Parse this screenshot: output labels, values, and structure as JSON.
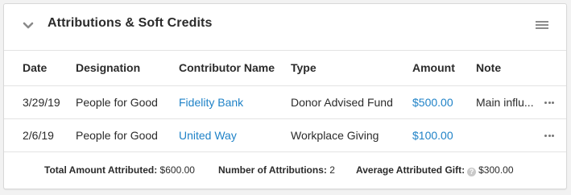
{
  "panel": {
    "title": "Attributions & Soft Credits",
    "collapse_icon": "chevron-down-icon",
    "menu_icon": "hamburger-menu-icon"
  },
  "table": {
    "columns": [
      "Date",
      "Designation",
      "Contributor Name",
      "Type",
      "Amount",
      "Note"
    ],
    "rows": [
      {
        "date": "3/29/19",
        "designation": "People for Good",
        "contributor": "Fidelity Bank",
        "type": "Donor Advised Fund",
        "amount": "$500.00",
        "note": "Main influ..."
      },
      {
        "date": "2/6/19",
        "designation": "People for Good",
        "contributor": "United Way",
        "type": "Workplace Giving",
        "amount": "$100.00",
        "note": ""
      }
    ]
  },
  "summary": {
    "total_label": "Total Amount Attributed:",
    "total_value": "$600.00",
    "count_label": "Number of Attributions:",
    "count_value": "2",
    "average_label": "Average Attributed Gift:",
    "average_value": "$300.00",
    "help_icon": "question-circle-icon"
  },
  "colors": {
    "link": "#1f82c7",
    "text": "#2b2b2b",
    "border": "#e3e3e3"
  }
}
